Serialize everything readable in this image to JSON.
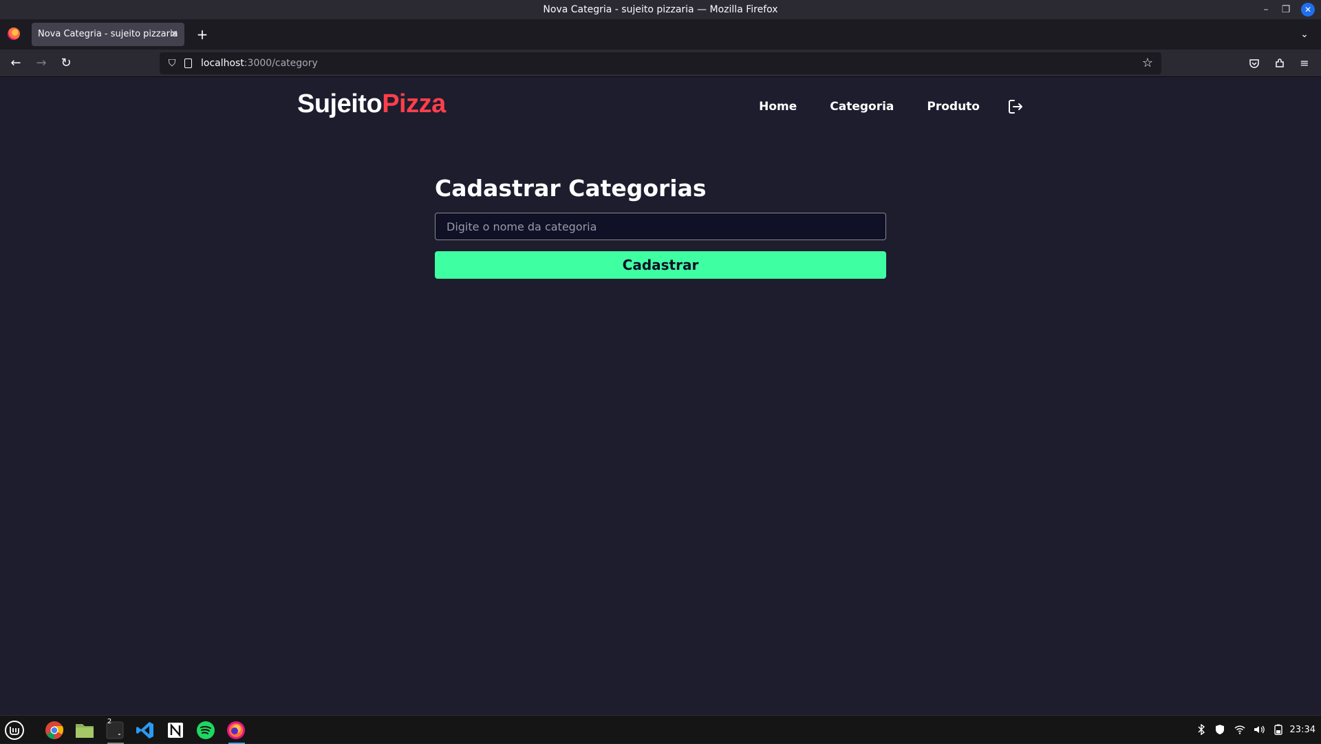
{
  "window": {
    "title": "Nova Categria - sujeito pizzaria — Mozilla Firefox"
  },
  "browser": {
    "tab_title": "Nova Categria - sujeito pizzaria",
    "url_host": "localhost",
    "url_path": ":3000/category"
  },
  "page": {
    "logo_part1": "Sujeito",
    "logo_part2": "Pizza",
    "nav": {
      "home": "Home",
      "category": "Categoria",
      "product": "Produto"
    },
    "form": {
      "title": "Cadastrar Categorias",
      "input_placeholder": "Digite o nome da categoria",
      "input_value": "",
      "submit_label": "Cadastrar"
    },
    "colors": {
      "background": "#1d1d2e",
      "accent_red": "#ff3f4b",
      "button_green": "#3fffa3"
    }
  },
  "taskbar": {
    "terminal_badge": "2",
    "clock": "23:34"
  },
  "icons": [
    "firefox-icon",
    "close-icon",
    "plus-icon",
    "chevron-down-icon",
    "back-icon",
    "forward-icon",
    "reload-icon",
    "shield-icon",
    "page-icon",
    "star-icon",
    "pocket-icon",
    "extensions-icon",
    "menu-icon",
    "logout-icon",
    "mint-menu-icon",
    "chrome-icon",
    "files-icon",
    "terminal-icon",
    "vscode-icon",
    "notion-icon",
    "spotify-icon",
    "bluetooth-icon",
    "security-icon",
    "wifi-icon",
    "volume-icon",
    "battery-icon"
  ]
}
